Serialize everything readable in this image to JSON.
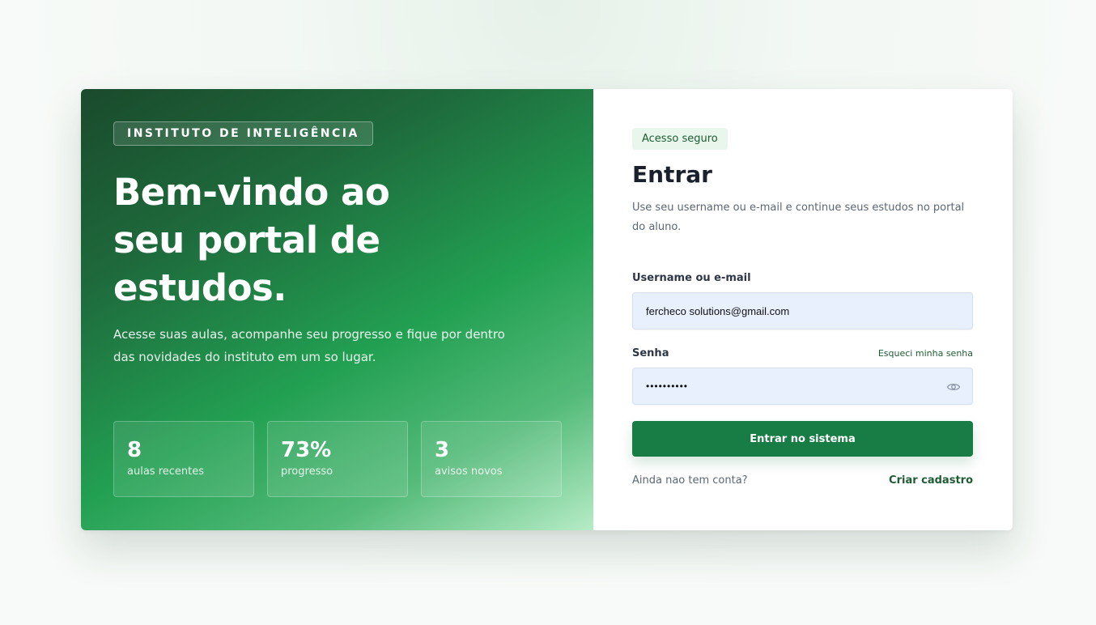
{
  "hero": {
    "eyebrow": "INSTITUTO DE INTELIGÊNCIA",
    "title": "Bem-vindo ao seu portal de estudos.",
    "lead": "Acesse suas aulas, acompanhe seu progresso e fique por dentro das novidades do instituto em um so lugar.",
    "stats": [
      {
        "value": "8",
        "label": "aulas recentes"
      },
      {
        "value": "73%",
        "label": "progresso"
      },
      {
        "value": "3",
        "label": "avisos novos"
      }
    ]
  },
  "login": {
    "badge": "Acesso seguro",
    "title": "Entrar",
    "description": "Use seu username ou e-mail e continue seus estudos no portal do aluno.",
    "username_label": "Username ou e-mail",
    "username_value": "fercheco solutions@gmail.com",
    "password_label": "Senha",
    "forgot_link": "Esqueci minha senha",
    "password_value": "••••••••••",
    "password_toggle_icon": "eye-icon",
    "submit_label": "Entrar no sistema",
    "signup_question": "Ainda nao tem conta?",
    "signup_link": "Criar cadastro"
  },
  "colors": {
    "primary": "#187c45",
    "hero_dark": "#1a4a2c",
    "hero_light": "#b6ecc6",
    "input_bg": "#e8f0fe"
  }
}
